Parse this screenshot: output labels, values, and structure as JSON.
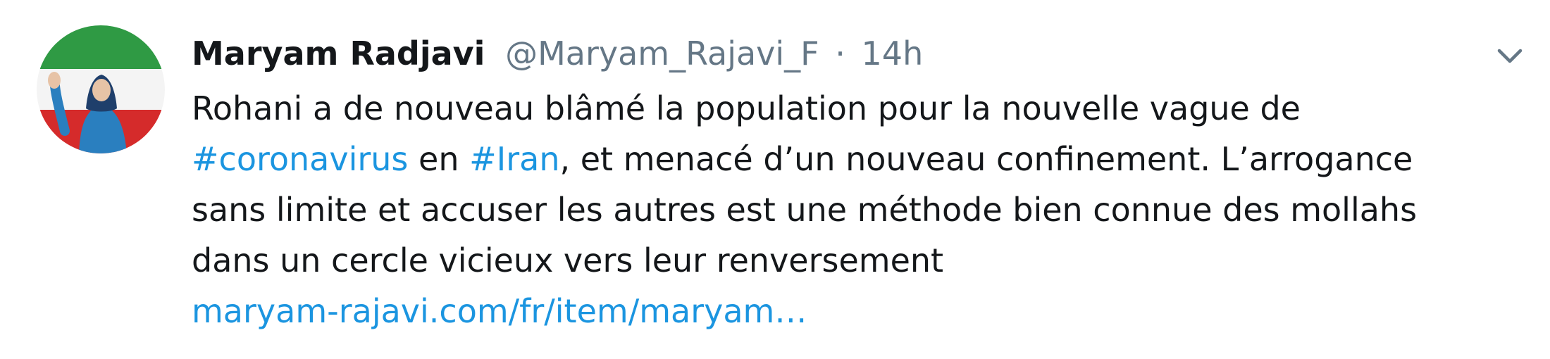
{
  "tweet": {
    "author": {
      "name": "Maryam Radjavi",
      "handle": "@Maryam_Rajavi_F",
      "separator": "·",
      "timestamp": "14h",
      "avatar_icon": "profile-photo"
    },
    "menu_icon": "chevron-down-icon",
    "text": {
      "line1": "Rohani a de nouveau blâmé la population pour la nouvelle vague de",
      "hashtag1": "#coronavirus",
      "line2_mid": " en ",
      "hashtag2": "#Iran",
      "line2_end": ", et menacé d’un nouveau confinement. L’arrogance",
      "line3": "sans limite et accuser les autres est une méthode bien connue des mollahs",
      "line4": "dans un cercle vicieux vers leur renversement",
      "url": "maryam-rajavi.com/fr/item/maryam…"
    },
    "colors": {
      "text": "#14171a",
      "secondary": "#657786",
      "link": "#1b95e0"
    }
  }
}
